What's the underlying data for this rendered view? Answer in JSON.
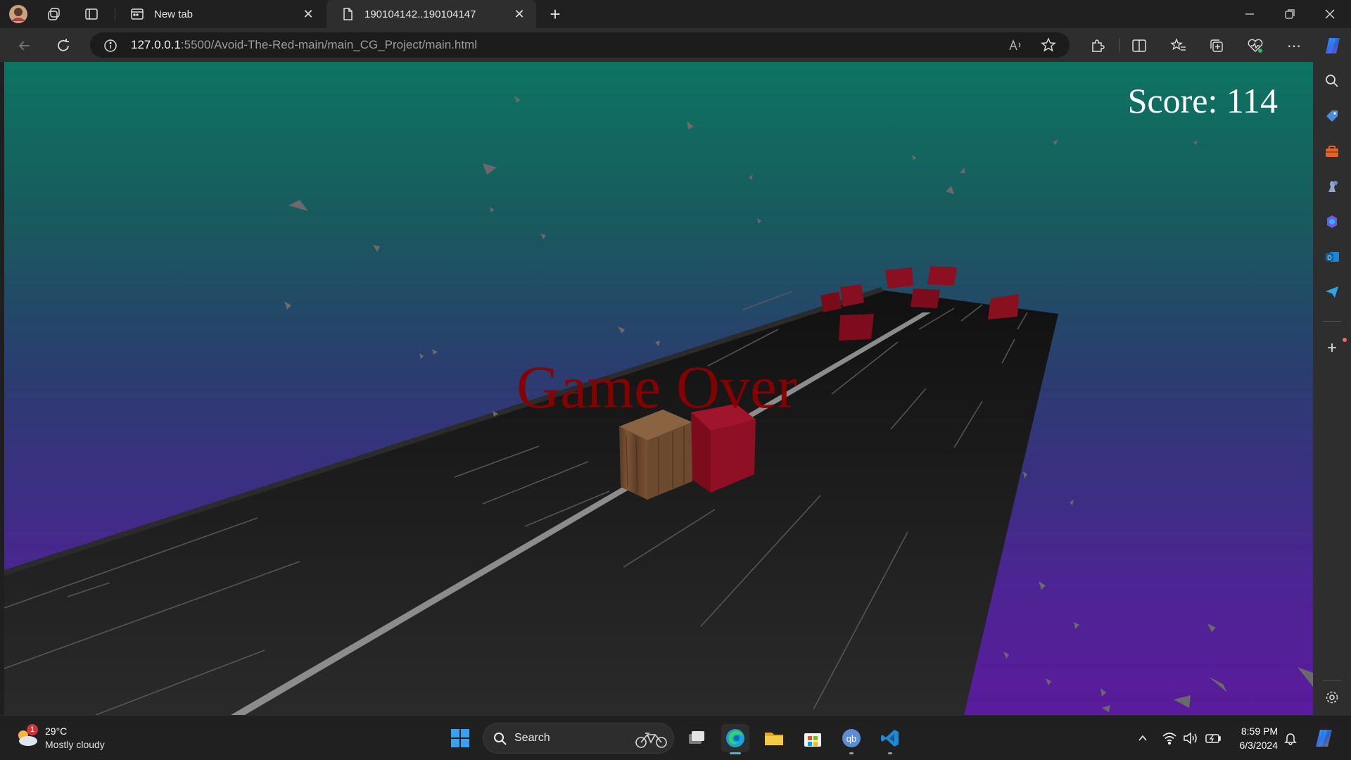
{
  "browser": {
    "tabs": [
      {
        "label": "New tab",
        "active": false
      },
      {
        "label": "190104142..190104147",
        "active": true
      }
    ],
    "url": {
      "host": "127.0.0.1",
      "path": ":5500/Avoid-The-Red-main/main_CG_Project/main.html"
    }
  },
  "game": {
    "score_text": "Score: 114",
    "game_over_text": "Game Over"
  },
  "taskbar": {
    "weather_temp": "29°C",
    "weather_desc": "Mostly cloudy",
    "weather_badge": "1",
    "search_label": "Search",
    "time": "8:59 PM",
    "date": "6/3/2024"
  },
  "colors": {
    "sky_top": "#0d7462",
    "sky_bottom": "#5a1b9c",
    "road": "#1e1e1e",
    "obstacle": "#8b0d1e",
    "game_over": "#8a0000"
  },
  "icons": [
    "profile-icon",
    "workspaces-icon",
    "tab-actions-icon",
    "back-icon",
    "refresh-icon",
    "site-info-icon",
    "read-aloud-icon",
    "favorite-star-icon",
    "extensions-icon",
    "split-screen-icon",
    "favorites-icon",
    "collections-icon",
    "browser-essentials-icon",
    "more-icon",
    "copilot-icon",
    "search-icon",
    "shopping-icon",
    "tools-icon",
    "games-icon",
    "office-icon",
    "outlook-icon",
    "send-icon",
    "add-icon",
    "settings-icon",
    "windows-start-icon",
    "task-view-icon",
    "edge-icon",
    "file-explorer-icon",
    "store-icon",
    "qbittorrent-icon",
    "vscode-icon",
    "wifi-icon",
    "volume-icon",
    "battery-icon",
    "notification-icon"
  ]
}
